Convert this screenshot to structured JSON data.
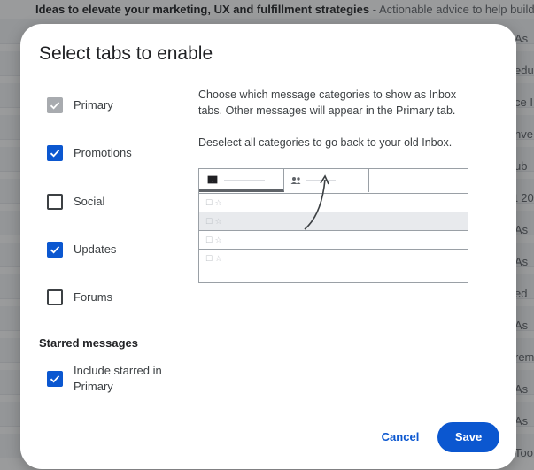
{
  "background": {
    "banner_title": "Ideas to elevate your marketing, UX and fulfillment strategies",
    "banner_snippet": " - Actionable advice to help build yo",
    "row_snippets": [
      "As",
      "edu",
      "ce I",
      "nve",
      "ub",
      "t 20",
      "As",
      "As",
      "ed",
      "As",
      "rem",
      "As",
      "As",
      "Too"
    ]
  },
  "dialog": {
    "title": "Select tabs to enable",
    "tabs": [
      {
        "label": "Primary",
        "state": "disabled-checked"
      },
      {
        "label": "Promotions",
        "state": "checked"
      },
      {
        "label": "Social",
        "state": "unchecked"
      },
      {
        "label": "Updates",
        "state": "checked"
      },
      {
        "label": "Forums",
        "state": "unchecked"
      }
    ],
    "starred_heading": "Starred messages",
    "starred_option": {
      "label": "Include starred in Primary",
      "state": "checked"
    },
    "description_1": "Choose which message categories to show as Inbox tabs. Other messages will appear in the Primary tab.",
    "description_2": "Deselect all categories to go back to your old Inbox.",
    "illustration": {
      "row_marker": "☐ ☆",
      "highlighted_row_index": 1
    },
    "cancel_label": "Cancel",
    "save_label": "Save"
  },
  "colors": {
    "accent": "#0b57d0",
    "scrim": "#202124",
    "checkbox_disabled": "#a8abaf"
  }
}
